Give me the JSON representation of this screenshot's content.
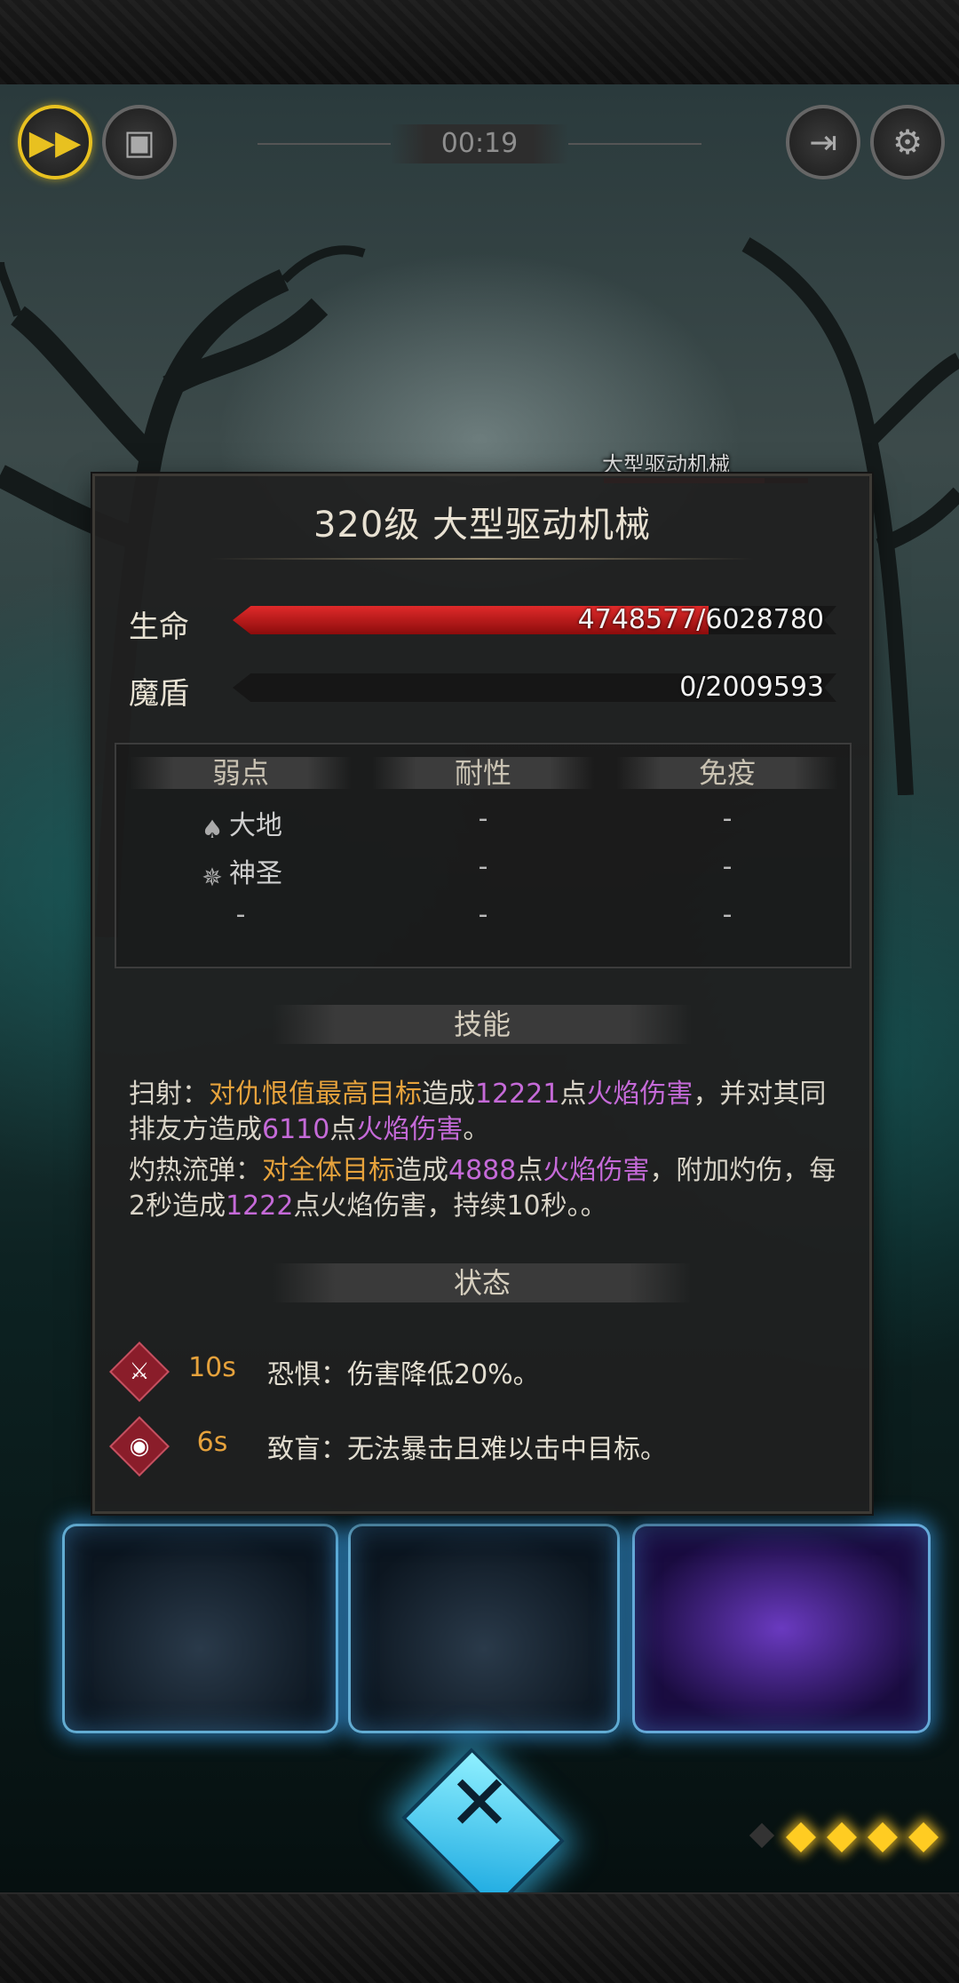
{
  "hud": {
    "timer": "00:19",
    "fast_forward_icon": "fast-forward-icon",
    "auto_icon": "auto-battle-icon",
    "exit_icon": "exit-icon",
    "settings_icon": "gear-icon"
  },
  "boss": {
    "name": "大型驱动机械",
    "hp_fraction": 0.7875
  },
  "panel": {
    "title": "320级  大型驱动机械",
    "stats": [
      {
        "label": "生命",
        "text": "4748577/6028780",
        "fraction": 0.7875,
        "color": "#c41c1c"
      },
      {
        "label": "魔盾",
        "text": "0/2009593",
        "fraction": 0,
        "color": "#4a4a4a"
      }
    ],
    "resist": {
      "headers": [
        "弱点",
        "耐性",
        "免疫"
      ],
      "rows": [
        [
          "大地",
          "-",
          "-"
        ],
        [
          "神圣",
          "-",
          "-"
        ],
        [
          "-",
          "-",
          "-"
        ]
      ]
    },
    "skills_head": "技能",
    "skills": [
      {
        "name": "扫射：",
        "target": "对仇恨值最高目标",
        "t1": "造成",
        "n1": "12221",
        "t2": "点",
        "dmg1": "火焰伤害",
        "t3": "，并对其同排友方造成",
        "n2": "6110",
        "t4": "点",
        "dmg2": "火焰伤害",
        "t5": "。"
      },
      {
        "name": "灼热流弹：",
        "target": "对全体目标",
        "t1": "造成",
        "n1": "4888",
        "t2": "点",
        "dmg1": "火焰伤害",
        "t3": "，附加灼伤，每2秒造成",
        "n2": "1222",
        "t4": "点火焰伤害，持续10秒。。"
      }
    ],
    "status_head": "状态",
    "statuses": [
      {
        "icon": "fear-icon",
        "time": "10s",
        "desc": "恐惧：伤害降低20%。"
      },
      {
        "icon": "blind-eye-icon",
        "time": "6s",
        "desc": "致盲：无法暴击且难以击中目标。"
      }
    ]
  },
  "turn_dots": {
    "total": 5,
    "active": 4
  }
}
